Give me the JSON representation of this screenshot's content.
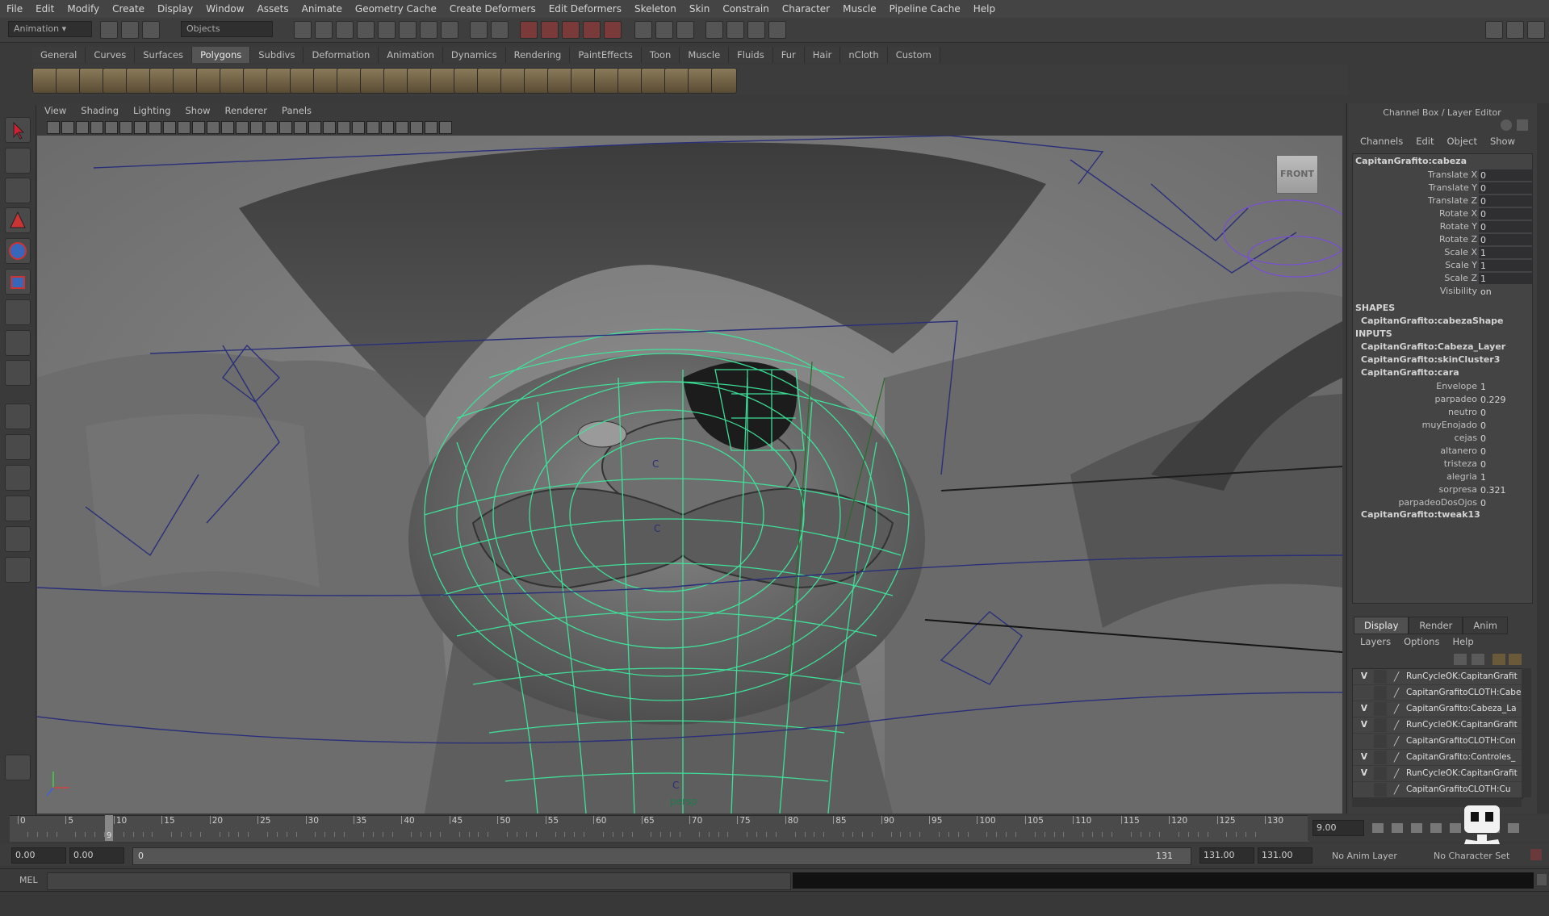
{
  "menubar": [
    "File",
    "Edit",
    "Modify",
    "Create",
    "Display",
    "Window",
    "Assets",
    "Animate",
    "Geometry Cache",
    "Create Deformers",
    "Edit Deformers",
    "Skeleton",
    "Skin",
    "Constrain",
    "Character",
    "Muscle",
    "Pipeline Cache",
    "Help"
  ],
  "statusline": {
    "menuset": "Animation",
    "selection_mode": "Objects"
  },
  "shelf_tabs": [
    "General",
    "Curves",
    "Surfaces",
    "Polygons",
    "Subdivs",
    "Deformation",
    "Animation",
    "Dynamics",
    "Rendering",
    "PaintEffects",
    "Toon",
    "Muscle",
    "Fluids",
    "Fur",
    "Hair",
    "nCloth",
    "Custom"
  ],
  "shelf_active_tab": "Polygons",
  "viewport": {
    "menu": [
      "View",
      "Shading",
      "Lighting",
      "Show",
      "Renderer",
      "Panels"
    ],
    "camera_label": "persp",
    "viewcube_label": "FRONT",
    "joint_markers": [
      "C",
      "C",
      "C"
    ]
  },
  "channel_box": {
    "title": "Channel Box / Layer Editor",
    "menu": [
      "Channels",
      "Edit",
      "Object",
      "Show"
    ],
    "object_name": "CapitanGrafito:cabeza",
    "channels": [
      {
        "label": "Translate X",
        "value": "0"
      },
      {
        "label": "Translate Y",
        "value": "0"
      },
      {
        "label": "Translate Z",
        "value": "0"
      },
      {
        "label": "Rotate X",
        "value": "0"
      },
      {
        "label": "Rotate Y",
        "value": "0"
      },
      {
        "label": "Rotate Z",
        "value": "0"
      },
      {
        "label": "Scale X",
        "value": "1"
      },
      {
        "label": "Scale Y",
        "value": "1"
      },
      {
        "label": "Scale Z",
        "value": "1"
      },
      {
        "label": "Visibility",
        "value": "on"
      }
    ],
    "shapes_header": "SHAPES",
    "shape_name": "CapitanGrafito:cabezaShape",
    "inputs_header": "INPUTS",
    "inputs": [
      "CapitanGrafito:Cabeza_Layer",
      "CapitanGrafito:skinCluster3",
      "CapitanGrafito:cara"
    ],
    "blend_attrs": [
      {
        "label": "Envelope",
        "value": "1"
      },
      {
        "label": "parpadeo",
        "value": "0.229"
      },
      {
        "label": "neutro",
        "value": "0"
      },
      {
        "label": "muyEnojado",
        "value": "0"
      },
      {
        "label": "cejas",
        "value": "0"
      },
      {
        "label": "altanero",
        "value": "0"
      },
      {
        "label": "tristeza",
        "value": "0"
      },
      {
        "label": "alegria",
        "value": "1"
      },
      {
        "label": "sorpresa",
        "value": "0.321"
      },
      {
        "label": "parpadeoDosOjos",
        "value": "0"
      }
    ],
    "last_input": "CapitanGrafito:tweak13"
  },
  "layer_editor": {
    "tabs": [
      "Display",
      "Render",
      "Anim"
    ],
    "active_tab": "Display",
    "menu": [
      "Layers",
      "Options",
      "Help"
    ],
    "layers": [
      {
        "visible": "V",
        "name": "RunCycleOK:CapitanGrafit"
      },
      {
        "visible": "",
        "name": "CapitanGrafitoCLOTH:Cabe"
      },
      {
        "visible": "V",
        "name": "CapitanGrafito:Cabeza_La"
      },
      {
        "visible": "V",
        "name": "RunCycleOK:CapitanGrafit"
      },
      {
        "visible": "",
        "name": "CapitanGrafitoCLOTH:Con"
      },
      {
        "visible": "V",
        "name": "CapitanGrafito:Controles_"
      },
      {
        "visible": "V",
        "name": "RunCycleOK:CapitanGrafit"
      },
      {
        "visible": "",
        "name": "CapitanGrafitoCLOTH:Cu"
      }
    ]
  },
  "timeline": {
    "ticks": [
      "0",
      "5",
      "10",
      "15",
      "20",
      "25",
      "30",
      "35",
      "40",
      "45",
      "50",
      "55",
      "60",
      "65",
      "70",
      "75",
      "80",
      "85",
      "90",
      "95",
      "100",
      "105",
      "110",
      "115",
      "120",
      "125",
      "130"
    ],
    "current_frame_marker": "9",
    "current_time": "9.00"
  },
  "range": {
    "start_time": "0.00",
    "range_start": "0.00",
    "slider_left": "0",
    "slider_right": "131",
    "range_end": "131.00",
    "end_time": "131.00",
    "anim_layer": "No Anim Layer",
    "character_set": "No Character Set"
  },
  "cmdline": {
    "label": "MEL"
  },
  "colors": {
    "wireframe": "#3de79c",
    "background": "#7b7b7b",
    "panel": "#3d3d3d"
  }
}
